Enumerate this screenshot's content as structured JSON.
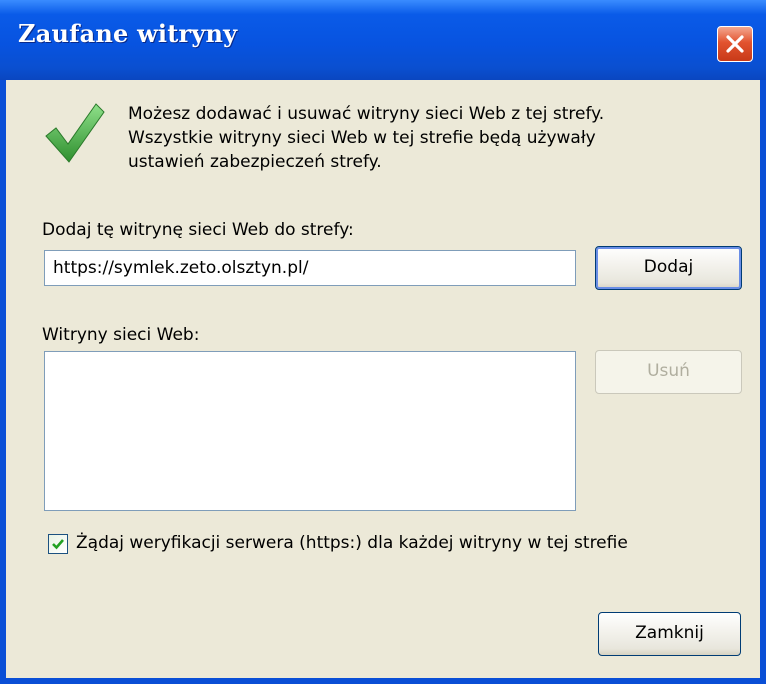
{
  "window": {
    "title": "Zaufane witryny",
    "close_icon": "close-icon"
  },
  "intro": {
    "icon": "checkmark-icon",
    "line1": "Możesz dodawać i usuwać witryny sieci Web z tej strefy.",
    "line2": "Wszystkie witryny sieci Web w tej strefie będą używały",
    "line3": "ustawień zabezpieczeń strefy."
  },
  "add_site": {
    "label": "Dodaj tę witrynę sieci Web do strefy:",
    "value": "https://symlek.zeto.olsztyn.pl/",
    "button_label": "Dodaj"
  },
  "sites": {
    "label": "Witryny sieci Web:",
    "items": [],
    "remove_label": "Usuń"
  },
  "require_https": {
    "checked": true,
    "label": "Żądaj weryfikacji serwera (https:) dla każdej witryny w tej strefie"
  },
  "footer": {
    "close_label": "Zamknij"
  },
  "colors": {
    "titlebar": "#0a5be8",
    "client_bg": "#ece9d8",
    "close_button": "#e2532f",
    "check_green": "#3aa13a"
  }
}
